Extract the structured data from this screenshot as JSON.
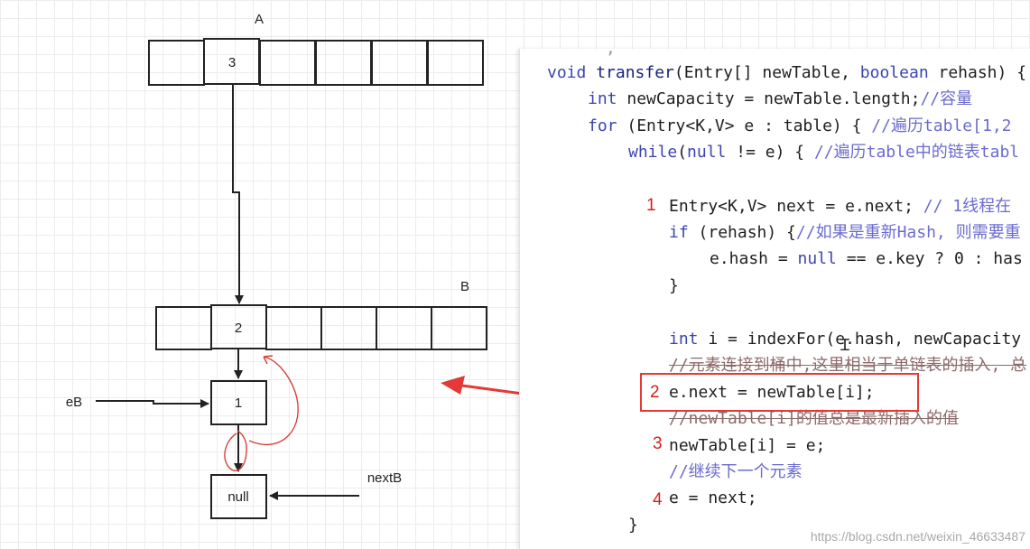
{
  "diagram": {
    "table_a": {
      "label": "A",
      "cell_values": [
        "",
        "3",
        "",
        "",
        "",
        ""
      ]
    },
    "table_b": {
      "label": "B",
      "cell_values": [
        "",
        "2",
        "",
        "",
        "",
        ""
      ]
    },
    "node_1": "1",
    "node_null": "null",
    "pointer_eb": "eB",
    "pointer_nextb": "nextB"
  },
  "code": {
    "lines": [
      [
        {
          "t": "void ",
          "c": "kw"
        },
        {
          "t": "transfer",
          "c": "fn"
        },
        {
          "t": "(Entry[] newTable, "
        },
        {
          "t": "boolean",
          "c": "kw"
        },
        {
          "t": " rehash) {"
        }
      ],
      [
        {
          "t": "int",
          "c": "kw"
        },
        {
          "t": " newCapacity = newTable.length;"
        },
        {
          "t": "//容量",
          "c": "cm"
        }
      ],
      [
        {
          "t": "for",
          "c": "kw"
        },
        {
          "t": " (Entry<K,V> e : table) { "
        },
        {
          "t": "//遍历table[1,2",
          "c": "cm"
        }
      ],
      [
        {
          "t": "while",
          "c": "kw"
        },
        {
          "t": "("
        },
        {
          "t": "null",
          "c": "kw"
        },
        {
          "t": " != e) { "
        },
        {
          "t": "//遍历table中的链表tabl",
          "c": "cm"
        }
      ],
      [
        {
          "t": "Entry<K,V> next = e.next; "
        },
        {
          "t": "// 1线程在",
          "c": "cm"
        }
      ],
      [
        {
          "t": "if",
          "c": "kw"
        },
        {
          "t": " (rehash) {"
        },
        {
          "t": "//如果是重新Hash, 则需要重",
          "c": "cm"
        }
      ],
      [
        {
          "t": "e.hash = "
        },
        {
          "t": "null",
          "c": "kw"
        },
        {
          "t": " == e.key ? 0 : has"
        }
      ],
      [
        {
          "t": "}"
        }
      ],
      [
        {
          "t": "int",
          "c": "kw"
        },
        {
          "t": " i = indexFor(e.hash, newCapacity"
        }
      ],
      [
        {
          "t": "//元素连接到桶中,这里相当于单链表的插入, 总",
          "c": "cm-strike"
        }
      ],
      [
        {
          "t": "e.next = newTable[i];"
        }
      ],
      [
        {
          "t": "//newTable[i]的值总是最新插入的值",
          "c": "cm-strike"
        }
      ],
      [
        {
          "t": "newTable[i] = e;"
        }
      ],
      [
        {
          "t": "//继续下一个元素",
          "c": "cm"
        }
      ],
      [
        {
          "t": "e = next;"
        }
      ],
      [
        {
          "t": "}"
        }
      ]
    ],
    "step_numbers": [
      "1",
      "2",
      "3",
      "4"
    ],
    "watermark": "https://blog.csdn.net/weixin_46633487"
  },
  "colors": {
    "annotation": "#e53935",
    "keyword": "#3c44b0",
    "comment": "#6b6bcf"
  }
}
